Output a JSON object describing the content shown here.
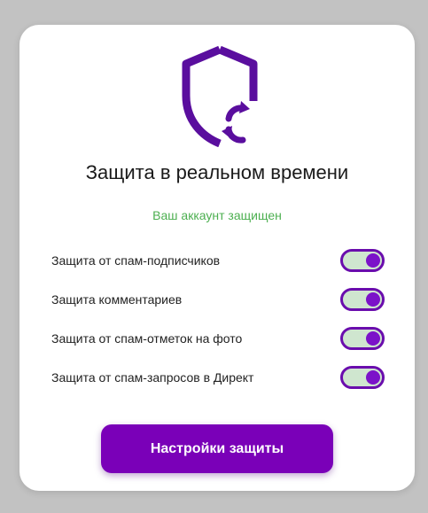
{
  "title": "Защита в реальном времени",
  "status": "Ваш аккаунт защищен",
  "colors": {
    "accent": "#7a00b8",
    "status": "#4caf50",
    "toggle_on_track": "#cfe6cf"
  },
  "icons": {
    "shield": "shield-sync-icon"
  },
  "settings": [
    {
      "label": "Защита от спам-подписчиков",
      "enabled": true
    },
    {
      "label": "Защита комментариев",
      "enabled": true
    },
    {
      "label": "Защита от спам-отметок на фото",
      "enabled": true
    },
    {
      "label": "Защита от спам-запросов в Директ",
      "enabled": true
    }
  ],
  "button": {
    "label": "Настройки защиты"
  }
}
